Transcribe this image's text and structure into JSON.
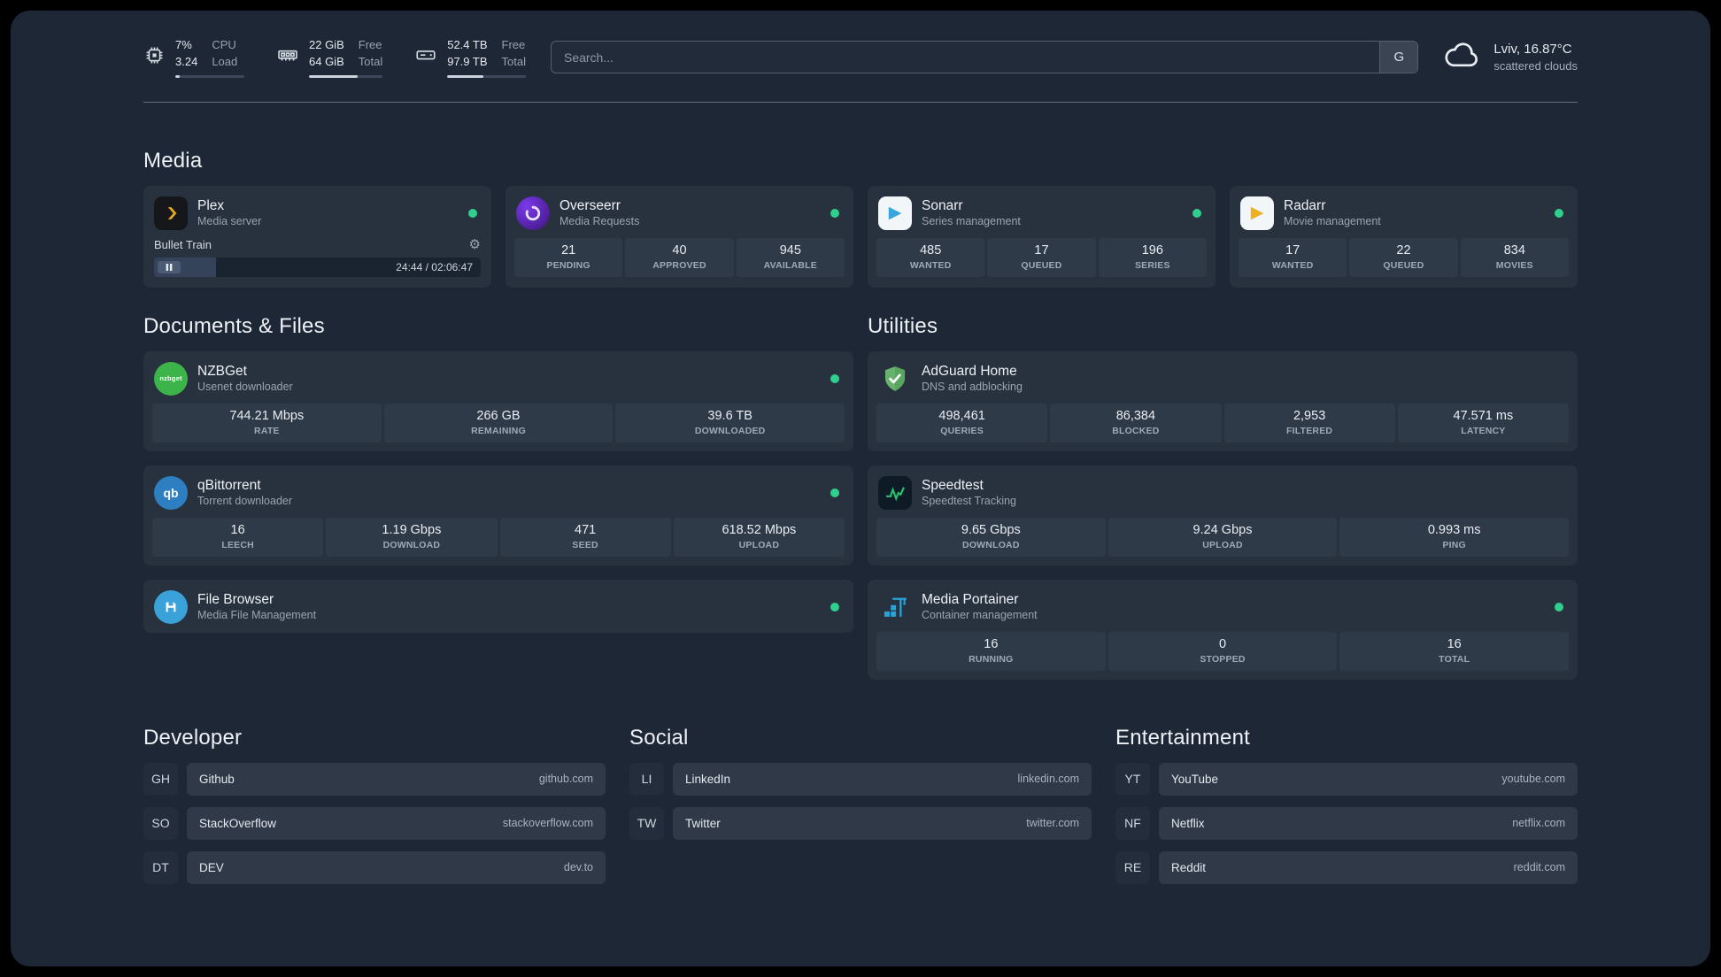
{
  "colors": {
    "page_bg": "#1d2736",
    "card_bg": "#28323f",
    "tile_bg": "#2f3a49",
    "status_online": "#2fcf8e",
    "plex_accent": "#e7a921",
    "radarr_accent": "#edb024",
    "sonarr_accent": "#36a6dd",
    "adguard_accent": "#67b36e",
    "speedtest_accent": "#27c46d",
    "portainer_accent": "#2aa3d8"
  },
  "icons": {
    "gear": "⚙",
    "sonarr_play": "▶",
    "radarr_play": "▶",
    "nzbget_label": "nzbget",
    "qb_label": "qb"
  },
  "topbar": {
    "cpu": {
      "value1": "7%",
      "value2": "3.24",
      "label1": "CPU",
      "label2": "Load",
      "bar_percent": 7
    },
    "memory": {
      "value1": "22 GiB",
      "value2": "64 GiB",
      "label1": "Free",
      "label2": "Total",
      "bar_percent": 66
    },
    "disk": {
      "value1": "52.4 TB",
      "value2": "97.9 TB",
      "label1": "Free",
      "label2": "Total",
      "bar_percent": 46
    },
    "search": {
      "placeholder": "Search...",
      "provider_label": "G"
    },
    "weather": {
      "location": "Lviv, 16.87°C",
      "condition": "scattered clouds"
    }
  },
  "media": {
    "title": "Media",
    "plex": {
      "name": "Plex",
      "subtitle": "Media server",
      "status": "online",
      "player": {
        "track": "Bullet Train",
        "time": "24:44 / 02:06:47",
        "progress_percent": 19
      }
    },
    "overseerr": {
      "name": "Overseerr",
      "subtitle": "Media Requests",
      "status": "online",
      "stats": [
        {
          "value": "21",
          "label": "PENDING"
        },
        {
          "value": "40",
          "label": "APPROVED"
        },
        {
          "value": "945",
          "label": "AVAILABLE"
        }
      ]
    },
    "sonarr": {
      "name": "Sonarr",
      "subtitle": "Series management",
      "status": "online",
      "stats": [
        {
          "value": "485",
          "label": "WANTED"
        },
        {
          "value": "17",
          "label": "QUEUED"
        },
        {
          "value": "196",
          "label": "SERIES"
        }
      ]
    },
    "radarr": {
      "name": "Radarr",
      "subtitle": "Movie management",
      "status": "online",
      "stats": [
        {
          "value": "17",
          "label": "WANTED"
        },
        {
          "value": "22",
          "label": "QUEUED"
        },
        {
          "value": "834",
          "label": "MOVIES"
        }
      ]
    }
  },
  "documents": {
    "title": "Documents & Files",
    "nzbget": {
      "name": "NZBGet",
      "subtitle": "Usenet downloader",
      "status": "online",
      "stats": [
        {
          "value": "744.21 Mbps",
          "label": "RATE"
        },
        {
          "value": "266 GB",
          "label": "REMAINING"
        },
        {
          "value": "39.6 TB",
          "label": "DOWNLOADED"
        }
      ]
    },
    "qbittorrent": {
      "name": "qBittorrent",
      "subtitle": "Torrent downloader",
      "status": "online",
      "stats": [
        {
          "value": "16",
          "label": "LEECH"
        },
        {
          "value": "1.19 Gbps",
          "label": "DOWNLOAD"
        },
        {
          "value": "471",
          "label": "SEED"
        },
        {
          "value": "618.52 Mbps",
          "label": "UPLOAD"
        }
      ]
    },
    "filebrowser": {
      "name": "File Browser",
      "subtitle": "Media File Management",
      "status": "online"
    }
  },
  "utilities": {
    "title": "Utilities",
    "adguard": {
      "name": "AdGuard Home",
      "subtitle": "DNS and adblocking",
      "stats": [
        {
          "value": "498,461",
          "label": "QUERIES"
        },
        {
          "value": "86,384",
          "label": "BLOCKED"
        },
        {
          "value": "2,953",
          "label": "FILTERED"
        },
        {
          "value": "47.571 ms",
          "label": "LATENCY"
        }
      ]
    },
    "speedtest": {
      "name": "Speedtest",
      "subtitle": "Speedtest Tracking",
      "stats": [
        {
          "value": "9.65 Gbps",
          "label": "DOWNLOAD"
        },
        {
          "value": "9.24 Gbps",
          "label": "UPLOAD"
        },
        {
          "value": "0.993 ms",
          "label": "PING"
        }
      ]
    },
    "portainer": {
      "name": "Media Portainer",
      "subtitle": "Container management",
      "status": "online",
      "stats": [
        {
          "value": "16",
          "label": "RUNNING"
        },
        {
          "value": "0",
          "label": "STOPPED"
        },
        {
          "value": "16",
          "label": "TOTAL"
        }
      ]
    }
  },
  "bookmarks": {
    "developer": {
      "title": "Developer",
      "items": [
        {
          "abbr": "GH",
          "name": "Github",
          "url": "github.com"
        },
        {
          "abbr": "SO",
          "name": "StackOverflow",
          "url": "stackoverflow.com"
        },
        {
          "abbr": "DT",
          "name": "DEV",
          "url": "dev.to"
        }
      ]
    },
    "social": {
      "title": "Social",
      "items": [
        {
          "abbr": "LI",
          "name": "LinkedIn",
          "url": "linkedin.com"
        },
        {
          "abbr": "TW",
          "name": "Twitter",
          "url": "twitter.com"
        }
      ]
    },
    "entertainment": {
      "title": "Entertainment",
      "items": [
        {
          "abbr": "YT",
          "name": "YouTube",
          "url": "youtube.com"
        },
        {
          "abbr": "NF",
          "name": "Netflix",
          "url": "netflix.com"
        },
        {
          "abbr": "RE",
          "name": "Reddit",
          "url": "reddit.com"
        }
      ]
    }
  }
}
